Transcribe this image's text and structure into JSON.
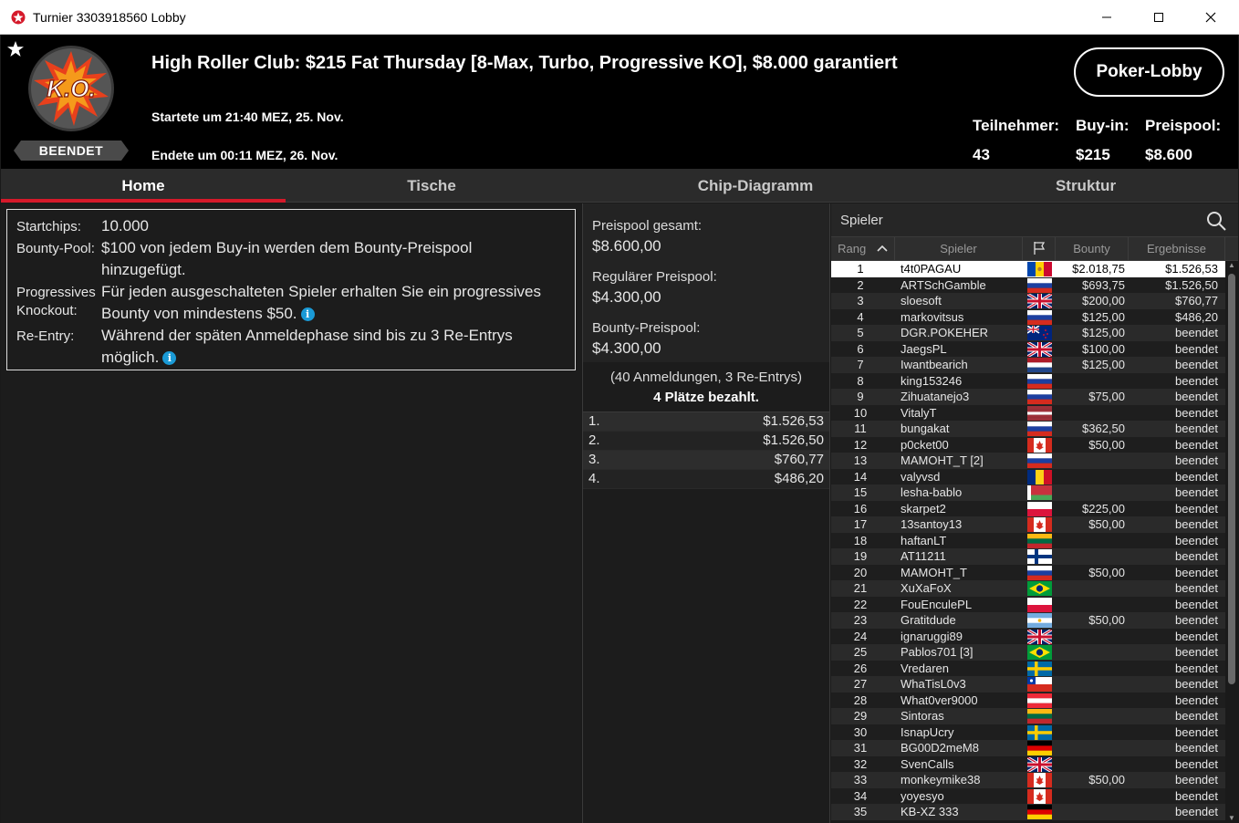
{
  "window": {
    "title": "Turnier 3303918560 Lobby",
    "minimize": "—",
    "maximize": "☐",
    "close": "✕"
  },
  "header": {
    "ko_text": "K.O.",
    "status_badge": "BEENDET",
    "tournament_title": "High Roller Club: $215 Fat Thursday [8-Max, Turbo, Progressive KO], $8.000  garantiert",
    "start_text": "Startete um 21:40 MEZ, 25. Nov.",
    "end_text": "Endete um 00:11 MEZ, 26. Nov.",
    "lobby_button": "Poker-Lobby",
    "stats": {
      "players_label": "Teilnehmer:",
      "players_value": "43",
      "buyin_label": "Buy-in:",
      "buyin_value": "$215",
      "prizepool_label": "Preispool:",
      "prizepool_value": "$8.600"
    }
  },
  "tabs": [
    "Home",
    "Tische",
    "Chip-Diagramm",
    "Struktur"
  ],
  "info": {
    "startchips_label": "Startchips:",
    "startchips_value": "10.000",
    "bountypool_label": "Bounty-Pool:",
    "bountypool_line1": "$100 von jedem Buy-in werden dem Bounty-Preispool",
    "bountypool_line2": "hinzugefügt.",
    "pko_label1": "Progressives",
    "pko_label2": "Knockout:",
    "pko_line1": "Für jeden ausgeschalteten Spieler erhalten Sie ein progressives",
    "pko_line2": "Bounty von mindestens $50.",
    "reentry_label": "Re-Entry:",
    "reentry_line1": "Während der späten Anmeldephase sind bis zu 3 Re-Entrys",
    "reentry_line2": "möglich."
  },
  "prizepool": {
    "total_label": "Preispool gesamt:",
    "total_value": "$8.600,00",
    "regular_label": "Regulärer Preispool:",
    "regular_value": "$4.300,00",
    "bounty_label": "Bounty-Preispool:",
    "bounty_value": "$4.300,00",
    "registrations": "(40 Anmeldungen, 3 Re-Entrys)",
    "paid_places": "4 Plätze bezahlt.",
    "payouts": [
      {
        "place": "1.",
        "amount": "$1.526,53"
      },
      {
        "place": "2.",
        "amount": "$1.526,50"
      },
      {
        "place": "3.",
        "amount": "$760,77"
      },
      {
        "place": "4.",
        "amount": "$486,20"
      }
    ]
  },
  "players": {
    "header": "Spieler",
    "columns": {
      "rank": "Rang",
      "player": "Spieler",
      "bounty": "Bounty",
      "result": "Ergebnisse"
    },
    "rows": [
      {
        "rank": "1",
        "name": "t4t0PAGAU",
        "flag": "md",
        "bounty": "$2.018,75",
        "result": "$1.526,53"
      },
      {
        "rank": "2",
        "name": "ARTSchGamble",
        "flag": "ru",
        "bounty": "$693,75",
        "result": "$1.526,50"
      },
      {
        "rank": "3",
        "name": "sloesoft",
        "flag": "gb",
        "bounty": "$200,00",
        "result": "$760,77"
      },
      {
        "rank": "4",
        "name": "markovitsus",
        "flag": "ru",
        "bounty": "$125,00",
        "result": "$486,20"
      },
      {
        "rank": "5",
        "name": "DGR.POKEHER",
        "flag": "nz",
        "bounty": "$125,00",
        "result": "beendet"
      },
      {
        "rank": "6",
        "name": "JaegsPL",
        "flag": "gb",
        "bounty": "$100,00",
        "result": "beendet"
      },
      {
        "rank": "7",
        "name": "Iwantbearich",
        "flag": "nl",
        "bounty": "$125,00",
        "result": "beendet"
      },
      {
        "rank": "8",
        "name": "king153246",
        "flag": "ru",
        "bounty": "",
        "result": "beendet"
      },
      {
        "rank": "9",
        "name": "Zihuatanejo3",
        "flag": "ru",
        "bounty": "$75,00",
        "result": "beendet"
      },
      {
        "rank": "10",
        "name": "VitalyT",
        "flag": "lv",
        "bounty": "",
        "result": "beendet"
      },
      {
        "rank": "11",
        "name": "bungakat",
        "flag": "ru",
        "bounty": "$362,50",
        "result": "beendet"
      },
      {
        "rank": "12",
        "name": "p0cket00",
        "flag": "ca",
        "bounty": "$50,00",
        "result": "beendet"
      },
      {
        "rank": "13",
        "name": "MAMOHT_T [2]",
        "flag": "ru",
        "bounty": "",
        "result": "beendet"
      },
      {
        "rank": "14",
        "name": "valyvsd",
        "flag": "ro",
        "bounty": "",
        "result": "beendet"
      },
      {
        "rank": "15",
        "name": "lesha-bablo",
        "flag": "by",
        "bounty": "",
        "result": "beendet"
      },
      {
        "rank": "16",
        "name": "skarpet2",
        "flag": "pl",
        "bounty": "$225,00",
        "result": "beendet"
      },
      {
        "rank": "17",
        "name": "13santoy13",
        "flag": "ca",
        "bounty": "$50,00",
        "result": "beendet"
      },
      {
        "rank": "18",
        "name": "haftanLT",
        "flag": "lt",
        "bounty": "",
        "result": "beendet"
      },
      {
        "rank": "19",
        "name": "AT11211",
        "flag": "fi",
        "bounty": "",
        "result": "beendet"
      },
      {
        "rank": "20",
        "name": "MAMOHT_T",
        "flag": "ru",
        "bounty": "$50,00",
        "result": "beendet"
      },
      {
        "rank": "21",
        "name": "XuXaFoX",
        "flag": "br",
        "bounty": "",
        "result": "beendet"
      },
      {
        "rank": "22",
        "name": "FouEnculePL",
        "flag": "pl",
        "bounty": "",
        "result": "beendet"
      },
      {
        "rank": "23",
        "name": "Gratitdude",
        "flag": "ar",
        "bounty": "$50,00",
        "result": "beendet"
      },
      {
        "rank": "24",
        "name": "ignaruggi89",
        "flag": "gb",
        "bounty": "",
        "result": "beendet"
      },
      {
        "rank": "25",
        "name": "Pablos701 [3]",
        "flag": "br",
        "bounty": "",
        "result": "beendet"
      },
      {
        "rank": "26",
        "name": "Vredaren",
        "flag": "se",
        "bounty": "",
        "result": "beendet"
      },
      {
        "rank": "27",
        "name": "WhaTisL0v3",
        "flag": "cl",
        "bounty": "",
        "result": "beendet"
      },
      {
        "rank": "28",
        "name": "What0ver9000",
        "flag": "at",
        "bounty": "",
        "result": "beendet"
      },
      {
        "rank": "29",
        "name": "Sintoras",
        "flag": "lt",
        "bounty": "",
        "result": "beendet"
      },
      {
        "rank": "30",
        "name": "IsnapUcry",
        "flag": "se",
        "bounty": "",
        "result": "beendet"
      },
      {
        "rank": "31",
        "name": "BG00D2meM8",
        "flag": "de",
        "bounty": "",
        "result": "beendet"
      },
      {
        "rank": "32",
        "name": "SvenCalls",
        "flag": "gb",
        "bounty": "",
        "result": "beendet"
      },
      {
        "rank": "33",
        "name": "monkeymike38",
        "flag": "ca",
        "bounty": "$50,00",
        "result": "beendet"
      },
      {
        "rank": "34",
        "name": "yoyesyo",
        "flag": "ca",
        "bounty": "",
        "result": "beendet"
      },
      {
        "rank": "35",
        "name": "KB-XZ 333",
        "flag": "de",
        "bounty": "",
        "result": "beendet"
      }
    ]
  },
  "colors": {
    "accent": "#d5192a",
    "info": "#1a9ad6"
  }
}
